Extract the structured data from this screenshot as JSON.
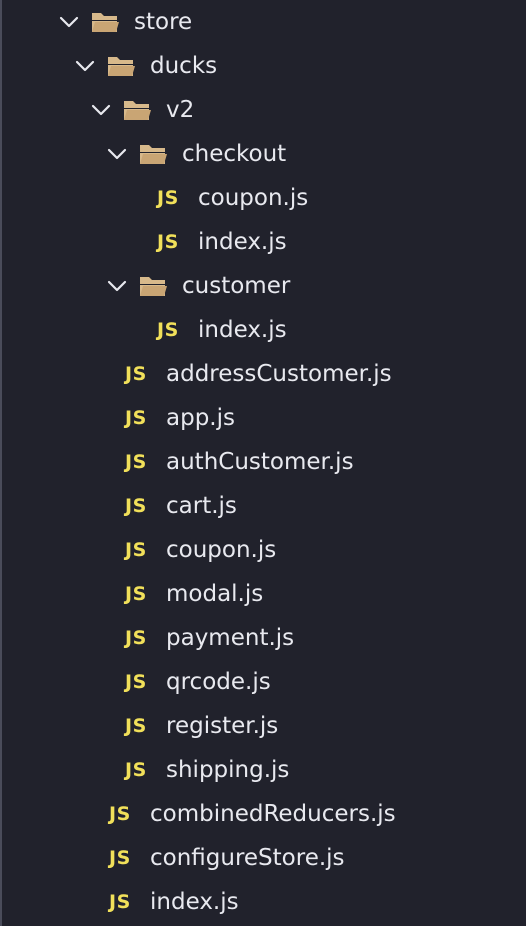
{
  "explorer": {
    "folders": {
      "store": "store",
      "ducks": "ducks",
      "v2": "v2",
      "checkout": "checkout",
      "customer": "customer"
    },
    "files": {
      "checkout_coupon": "coupon.js",
      "checkout_index": "index.js",
      "customer_index": "index.js",
      "v2_items": [
        "addressCustomer.js",
        "app.js",
        "authCustomer.js",
        "cart.js",
        "coupon.js",
        "modal.js",
        "payment.js",
        "qrcode.js",
        "register.js",
        "shipping.js"
      ],
      "ducks_items": [
        "combinedReducers.js",
        "configureStore.js",
        "index.js"
      ]
    },
    "js_badge": "JS",
    "icons": {
      "chevron": "chevron-down-icon",
      "folder": "folder-open-icon",
      "file": "js-file-icon"
    },
    "colors": {
      "background": "#21222c",
      "text": "#e8e9ef",
      "js_badge": "#f1e05a",
      "folder": "#d7b98b",
      "chevron": "#e8e9ef"
    }
  }
}
